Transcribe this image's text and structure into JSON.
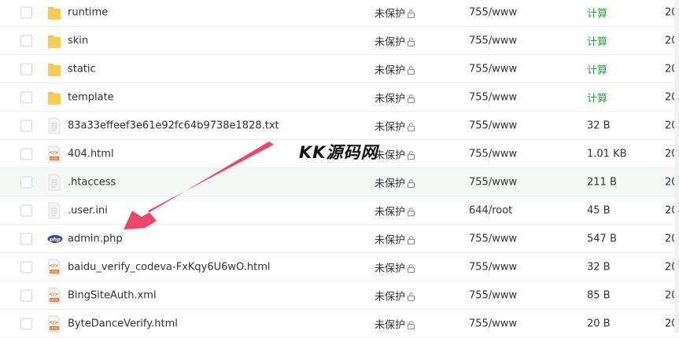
{
  "files": [
    {
      "name": "runtime",
      "type": "folder",
      "perm": "未保护",
      "mode": "755/www",
      "size": "计算",
      "size_is_action": true,
      "date": "20"
    },
    {
      "name": "skin",
      "type": "folder",
      "perm": "未保护",
      "mode": "755/www",
      "size": "计算",
      "size_is_action": true,
      "date": "20"
    },
    {
      "name": "static",
      "type": "folder",
      "perm": "未保护",
      "mode": "755/www",
      "size": "计算",
      "size_is_action": true,
      "date": "20"
    },
    {
      "name": "template",
      "type": "folder",
      "perm": "未保护",
      "mode": "755/www",
      "size": "计算",
      "size_is_action": true,
      "date": "20"
    },
    {
      "name": "83a33effeef3e61e92fc64b9738e1828.txt",
      "type": "txt",
      "perm": "未保护",
      "mode": "755/www",
      "size": "32 B",
      "size_is_action": false,
      "date": "20"
    },
    {
      "name": "404.html",
      "type": "html",
      "perm": "未保护",
      "mode": "755/www",
      "size": "1.01 KB",
      "size_is_action": false,
      "date": "20"
    },
    {
      "name": ".htaccess",
      "type": "txt",
      "perm": "未保护",
      "mode": "755/www",
      "size": "211 B",
      "size_is_action": false,
      "date": "20",
      "highlight": true
    },
    {
      "name": ".user.ini",
      "type": "txt",
      "perm": "未保护",
      "mode": "644/root",
      "size": "45 B",
      "size_is_action": false,
      "date": "20"
    },
    {
      "name": "admin.php",
      "type": "php",
      "perm": "未保护",
      "mode": "755/www",
      "size": "547 B",
      "size_is_action": false,
      "date": "20"
    },
    {
      "name": "baidu_verify_codeva-FxKqy6U6wO.html",
      "type": "html",
      "perm": "未保护",
      "mode": "755/www",
      "size": "32 B",
      "size_is_action": false,
      "date": "20"
    },
    {
      "name": "BingSiteAuth.xml",
      "type": "html",
      "perm": "未保护",
      "mode": "755/www",
      "size": "85 B",
      "size_is_action": false,
      "date": "20"
    },
    {
      "name": "ByteDanceVerify.html",
      "type": "html",
      "perm": "未保护",
      "mode": "755/www",
      "size": "20 B",
      "size_is_action": false,
      "date": "20"
    }
  ],
  "watermark": "KK源码网",
  "colors": {
    "accent": "#20a53a",
    "arrow": "#f0456a",
    "folder": "#f5c342"
  }
}
